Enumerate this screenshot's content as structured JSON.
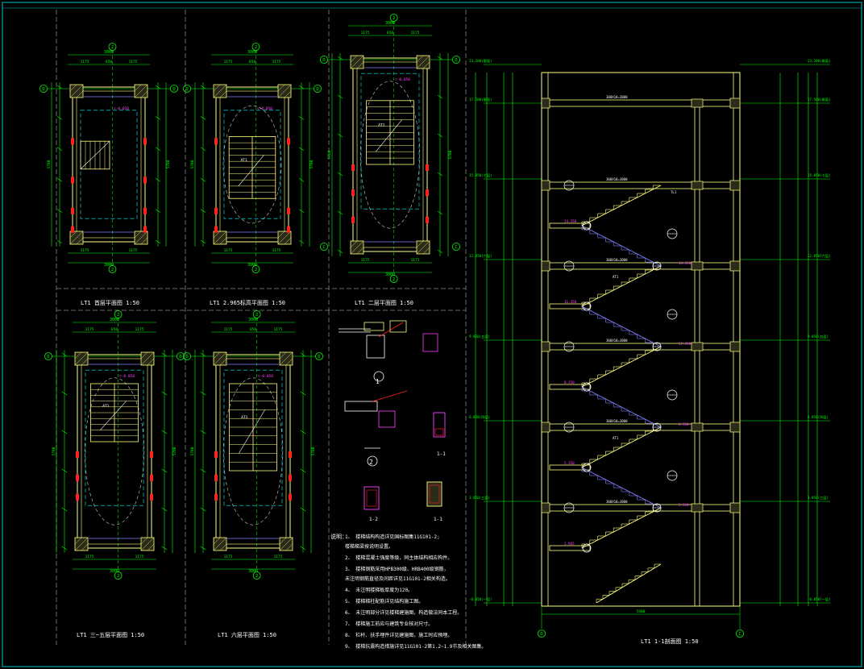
{
  "colors": {
    "background": "#000000",
    "frame": "#00c8c8",
    "axis": "#00ff00",
    "wall": "#ffff80",
    "beam": "#ffffff",
    "red": "#ff2020",
    "dim": "#00ff00",
    "label": "#ffffff",
    "magenta": "#ff40ff",
    "blue": "#8080ff",
    "dashed": "#00ffff"
  },
  "titles": {
    "plan1": "LT1 首层平面图 1:50",
    "plan2": "LT1 2.965标高平面图 1:50",
    "plan3": "LT1 二层平面图 1:50",
    "plan4": "LT1 三~五层平面图 1:50",
    "plan5": "LT1 六层平面图 1:50",
    "section": "LT1 1-1剖面图 1:50",
    "detail1": "1",
    "detail2": "2",
    "detail3": "1-1",
    "detail4": "1-2",
    "detail5": "1-1"
  },
  "plans": {
    "dims": {
      "top": "3000",
      "sub_a": "1175",
      "sub_b": "650",
      "sub_c": "1175",
      "side": "5700"
    },
    "axes": {
      "top": "2",
      "bottom": "2",
      "left": "D",
      "right": "D",
      "c_left": "C",
      "c_right": "C"
    }
  },
  "notes": {
    "header": "说明：",
    "items": [
      "1、 楼梯结构构造详见国标图集11G101-2;",
      "    楼梯梯梁按说明设置。",
      "2、 楼梯混凝土强度等级，同主体结构相应构件。",
      "3、 楼梯钢筋采用HPB300级、HRB400级钢筋，",
      "    未注明钢筋直径及间距详见11G101-2相关构造。",
      "4、 未注明楼梯板厚度为120。",
      "5、 楼梯梯柱配筋详见结构施工图。",
      "6、 未注明部分详见楼梯建施图，构造做法同本工程。",
      "7、 楼梯施工前应与建筑专业核对尺寸。",
      "8、 栏杆、扶手埋件详见建施图，施工时应预埋。",
      "9、 楼梯抗震构造措施详见11G101-2第1.2~1.9节及相关图集。"
    ]
  },
  "section": {
    "levels_left": [
      "23.200(屋面)",
      "17.500(屋面)",
      "15.850(七层)",
      "12.850(六层)",
      "9.850(五层)",
      "6.850(四层)",
      "3.850(三层)",
      "-0.050(一层)"
    ],
    "levels_right": [
      "23.200(屋面)",
      "17.500(屋面)",
      "15.850(七层)",
      "12.850(六层)",
      "9.850(五层)",
      "6.850(四层)",
      "3.850(三层)",
      "-0.050(一层)"
    ],
    "landing_levels": [
      "14.350",
      "11.350",
      "8.350",
      "5.350",
      "2.965",
      "1.450"
    ],
    "flight_label": "300X10=3000",
    "bottom_dim": "5400",
    "axis_left": "D",
    "axis_right": "C",
    "beam_tag": "TL1",
    "slab_tag": "AT1"
  }
}
